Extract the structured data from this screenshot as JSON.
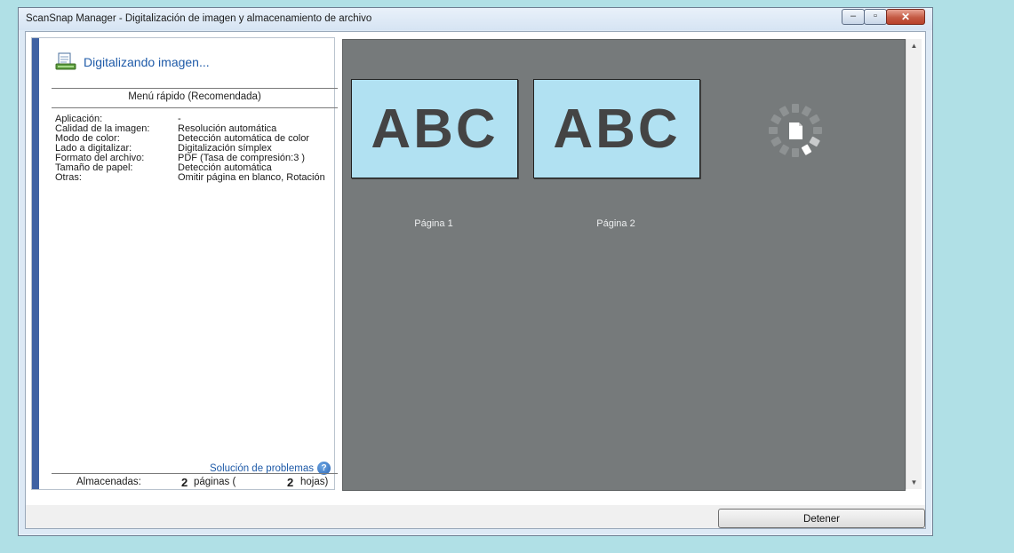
{
  "window": {
    "title": "ScanSnap Manager - Digitalización de imagen y almacenamiento de archivo",
    "controls": {
      "minimize": "–",
      "maximize": "▫",
      "close": "✕"
    }
  },
  "status": {
    "text": "Digitalizando imagen..."
  },
  "menu": {
    "title": "Menú rápido (Recomendada)"
  },
  "settings": [
    {
      "key": "Aplicación:",
      "value": "-"
    },
    {
      "key": "Calidad de la imagen:",
      "value": "Resolución automática"
    },
    {
      "key": "Modo de color:",
      "value": "Detección automática de color"
    },
    {
      "key": "Lado a digitalizar:",
      "value": "Digitalización símplex"
    },
    {
      "key": "Formato del archivo:",
      "value": "PDF (Tasa de compresión:3 )"
    },
    {
      "key": "Tamaño de papel:",
      "value": "Detección automática"
    },
    {
      "key": "Otras:",
      "value": "Omitir página en blanco, Rotación"
    }
  ],
  "troubleshoot": {
    "label": "Solución de problemas",
    "icon": "help-icon"
  },
  "footer": {
    "label": "Almacenadas:",
    "pages_count": "2",
    "pages_text": "páginas (",
    "sheets_count": "2",
    "sheets_text": "hojas)"
  },
  "preview": {
    "pages": [
      {
        "image_text": "ABC",
        "label": "Página 1"
      },
      {
        "image_text": "ABC",
        "label": "Página 2"
      }
    ],
    "spinner_icon": "loading-spinner-icon",
    "thumb_bg": "#b1e1f2",
    "background": "#767a7b"
  },
  "buttons": {
    "stop": "Detener"
  },
  "colors": {
    "accent": "#3f62a3",
    "link": "#1e5aa8",
    "desktop": "#b0e0e6"
  }
}
